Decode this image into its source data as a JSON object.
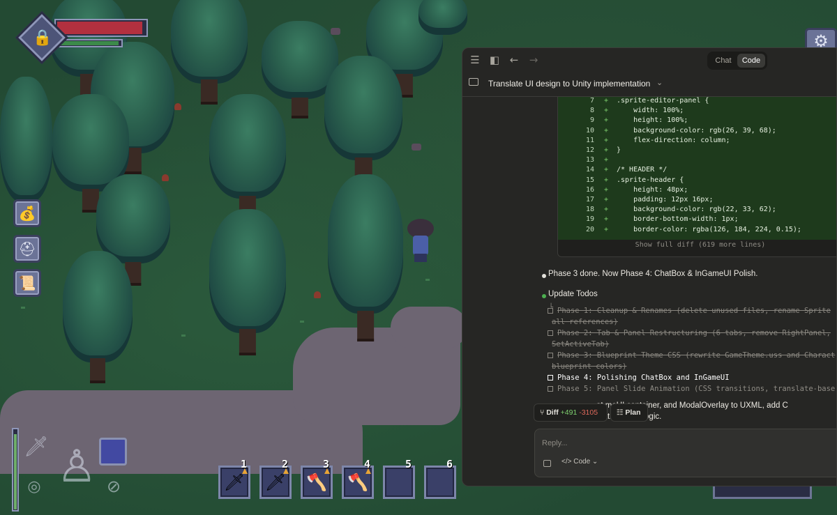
{
  "game": {
    "hud": {
      "hp_fraction": 0.97,
      "mp_fraction": 0.96,
      "stamina_fraction": 0.95,
      "portrait_icon": "lock-shield-icon"
    },
    "side_buttons": [
      {
        "icon": "coin-bag-icon"
      },
      {
        "icon": "helmet-icon"
      },
      {
        "icon": "scroll-map-icon"
      }
    ],
    "settings_icon": "gear-icon",
    "hotbar": [
      {
        "num": "1",
        "item": "sword-icon",
        "glyph": "🗡"
      },
      {
        "num": "2",
        "item": "sword-icon",
        "glyph": "🗡"
      },
      {
        "num": "3",
        "item": "axe-icon",
        "glyph": "🪓"
      },
      {
        "num": "4",
        "item": "axe-icon",
        "glyph": "🪓"
      },
      {
        "num": "5",
        "item": "",
        "glyph": ""
      },
      {
        "num": "6",
        "item": "",
        "glyph": ""
      }
    ]
  },
  "panel": {
    "modes": {
      "chat": "Chat",
      "code": "Code",
      "active": "Code"
    },
    "title": "Translate UI design to Unity implementation",
    "diff": {
      "lines": [
        {
          "n": "7",
          "code": ".sprite-editor-panel {"
        },
        {
          "n": "8",
          "code": "    width: 100%;"
        },
        {
          "n": "9",
          "code": "    height: 100%;"
        },
        {
          "n": "10",
          "code": "    background-color: rgb(26, 39, 68);"
        },
        {
          "n": "11",
          "code": "    flex-direction: column;"
        },
        {
          "n": "12",
          "code": "}"
        },
        {
          "n": "13",
          "code": ""
        },
        {
          "n": "14",
          "code": "/* HEADER */"
        },
        {
          "n": "15",
          "code": ".sprite-header {"
        },
        {
          "n": "16",
          "code": "    height: 48px;"
        },
        {
          "n": "17",
          "code": "    padding: 12px 16px;"
        },
        {
          "n": "18",
          "code": "    background-color: rgb(22, 33, 62);"
        },
        {
          "n": "19",
          "code": "    border-bottom-width: 1px;"
        },
        {
          "n": "20",
          "code": "    border-color: rgba(126, 184, 224, 0.15);"
        }
      ],
      "show_more": "Show full diff (619 more lines)"
    },
    "message_1": "Phase 3 done. Now Phase 4: ChatBox & InGameUI Polish.",
    "update_todos": "Update Todos",
    "todos": [
      {
        "text": "Phase 1: Cleanup & Renames (delete unused files, rename Sprite",
        "text2": "all references)",
        "state": "done"
      },
      {
        "text": "Phase 2: Tab & Panel Restructuring (6 tabs, remove RightPanel,",
        "text2": "SetActiveTab)",
        "state": "done"
      },
      {
        "text": "Phase 3: Blueprint Theme CSS (rewrite GameTheme.uss and Charact",
        "text2": "blueprint colors)",
        "state": "done"
      },
      {
        "text": "Phase 4: Polishing ChatBox and InGameUI",
        "text2": "",
        "state": "active"
      },
      {
        "text": "Phase 5: Panel Slide Animation (CSS transitions, translate-base",
        "text2": "",
        "state": "pending"
      }
    ],
    "partial_message_line1": "at        meUI container, and ModalOverlay to UXML, add C",
    "partial_message_line2": "o       atBox shift logic.",
    "chips": {
      "diff_label": "Diff",
      "diff_add": "+491",
      "diff_del": "-3105",
      "plan_label": "Plan"
    },
    "reply_placeholder": "Reply...",
    "reply_mode": "Code",
    "colors": {
      "accent_green": "#7fd06f",
      "delete_red": "#e06a5c",
      "bullet_green": "#4caf50"
    }
  }
}
